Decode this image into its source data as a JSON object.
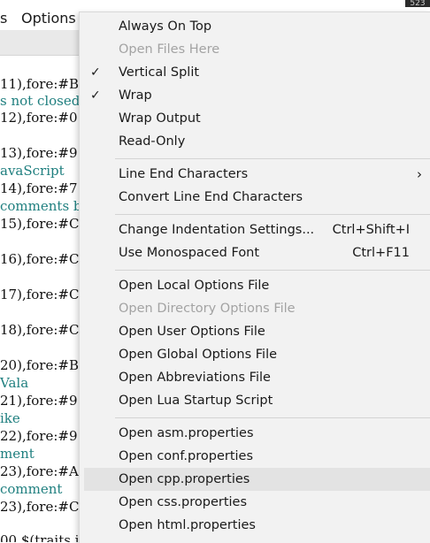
{
  "menubar": {
    "partial_item": "s",
    "options_label": "Options",
    "corner_text": "523"
  },
  "editor": {
    "lines": [
      {
        "text": "11),fore:#B",
        "style": "dark"
      },
      {
        "text": "s not closed",
        "style": "teal"
      },
      {
        "text": "12),fore:#0",
        "style": "dark"
      },
      {
        "text": "13),fore:#9",
        "style": "dark"
      },
      {
        "text": "avaScript",
        "style": "teal"
      },
      {
        "text": "14),fore:#7",
        "style": "dark"
      },
      {
        "text": "comments be",
        "style": "teal"
      },
      {
        "text": "15),fore:#C",
        "style": "dark"
      },
      {
        "text": "16),fore:#C",
        "style": "dark"
      },
      {
        "text": "17),fore:#C",
        "style": "dark"
      },
      {
        "text": "18),fore:#C",
        "style": "dark"
      },
      {
        "text": "20),fore:#B",
        "style": "dark"
      },
      {
        "text": "Vala",
        "style": "teal"
      },
      {
        "text": "21),fore:#9",
        "style": "dark"
      },
      {
        "text": "ike",
        "style": "teal"
      },
      {
        "text": "22),fore:#9",
        "style": "dark"
      },
      {
        "text": "ment",
        "style": "teal"
      },
      {
        "text": "23),fore:#A",
        "style": "dark"
      },
      {
        "text": "comment",
        "style": "teal"
      },
      {
        "text": "23),fore:#C",
        "style": "dark"
      },
      {
        "text": "00 $(traits i",
        "style": "dark"
      }
    ]
  },
  "menu": {
    "check_glyph": "✓",
    "submenu_arrow": "›",
    "items": [
      {
        "label": "Always On Top",
        "disabled": false,
        "checked": false
      },
      {
        "label": "Open Files Here",
        "disabled": true,
        "checked": false
      },
      {
        "label": "Vertical Split",
        "disabled": false,
        "checked": true
      },
      {
        "label": "Wrap",
        "disabled": false,
        "checked": true
      },
      {
        "label": "Wrap Output",
        "disabled": false,
        "checked": false
      },
      {
        "label": "Read-Only",
        "disabled": false,
        "checked": false
      },
      {
        "label": "Line End Characters",
        "disabled": false,
        "checked": false,
        "submenu": true
      },
      {
        "label": "Convert Line End Characters",
        "disabled": false,
        "checked": false
      },
      {
        "label": "Change Indentation Settings...",
        "shortcut": "Ctrl+Shift+I",
        "disabled": false,
        "checked": false
      },
      {
        "label": "Use Monospaced Font",
        "shortcut": "Ctrl+F11",
        "disabled": false,
        "checked": false
      },
      {
        "label": "Open Local Options File",
        "disabled": false,
        "checked": false
      },
      {
        "label": "Open Directory Options File",
        "disabled": true,
        "checked": false
      },
      {
        "label": "Open User Options File",
        "disabled": false,
        "checked": false
      },
      {
        "label": "Open Global Options File",
        "disabled": false,
        "checked": false
      },
      {
        "label": "Open Abbreviations File",
        "disabled": false,
        "checked": false
      },
      {
        "label": "Open Lua Startup Script",
        "disabled": false,
        "checked": false
      },
      {
        "label": "Open asm.properties",
        "disabled": false,
        "checked": false
      },
      {
        "label": "Open conf.properties",
        "disabled": false,
        "checked": false
      },
      {
        "label": "Open cpp.properties",
        "disabled": false,
        "checked": false,
        "highlighted": true
      },
      {
        "label": "Open css.properties",
        "disabled": false,
        "checked": false
      },
      {
        "label": "Open html.properties",
        "disabled": false,
        "checked": false
      }
    ]
  }
}
